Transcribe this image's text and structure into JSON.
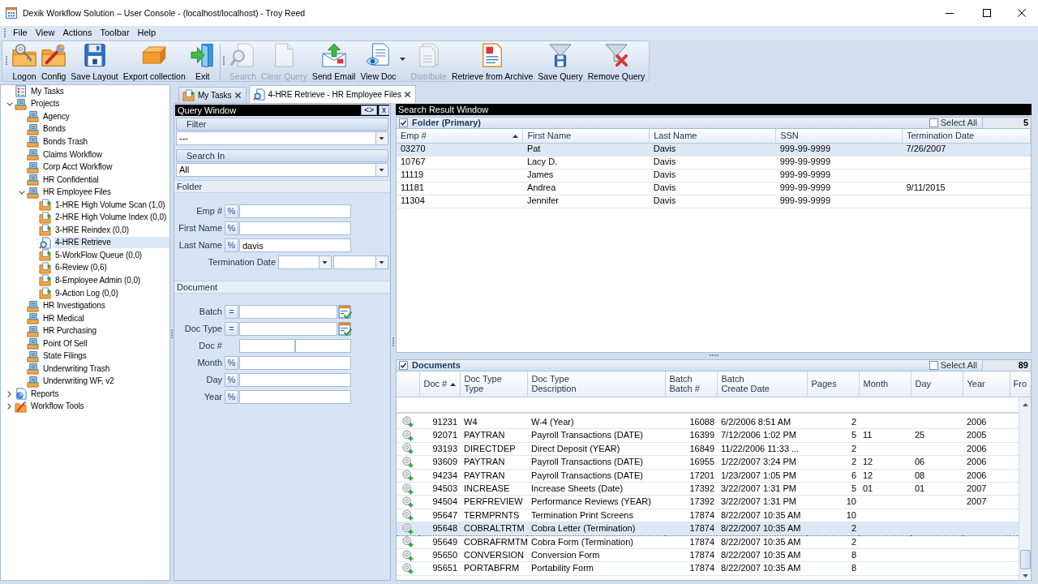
{
  "window": {
    "title": "Dexik Workflow Solution – User Console - (localhost/localhost) - Troy Reed"
  },
  "menu": [
    "File",
    "View",
    "Actions",
    "Toolbar",
    "Help"
  ],
  "toolbar": {
    "groups": [
      {
        "items": [
          {
            "label": "Logon",
            "disabled": false
          },
          {
            "label": "Config",
            "disabled": false
          },
          {
            "label": "Save Layout",
            "disabled": false
          },
          {
            "label": "Export collection",
            "disabled": false
          },
          {
            "label": "Exit",
            "disabled": false
          }
        ]
      },
      {
        "items": [
          {
            "label": "Search",
            "disabled": true
          },
          {
            "label": "Clear Query",
            "disabled": true
          },
          {
            "label": "Send Email",
            "disabled": false
          },
          {
            "label": "View Doc",
            "disabled": false,
            "dropdown": true
          },
          {
            "label": "Distribute",
            "disabled": true
          },
          {
            "label": "Retrieve from Archive",
            "disabled": false
          },
          {
            "label": "Save Query",
            "disabled": false
          },
          {
            "label": "Remove Query",
            "disabled": false
          }
        ]
      }
    ]
  },
  "tree": [
    {
      "label": "My Tasks",
      "kind": "tasks",
      "selected": false
    },
    {
      "label": "Projects",
      "kind": "project",
      "expanded": true,
      "selected": false,
      "children": [
        {
          "label": "Agency",
          "kind": "project",
          "selected": false
        },
        {
          "label": "Bonds",
          "kind": "project",
          "selected": false
        },
        {
          "label": "Bonds Trash",
          "kind": "project",
          "selected": false
        },
        {
          "label": "Claims Workflow",
          "kind": "project",
          "selected": false
        },
        {
          "label": "Corp Acct Workflow",
          "kind": "project",
          "selected": false
        },
        {
          "label": "HR Confidential",
          "kind": "project",
          "selected": false
        },
        {
          "label": "HR Employee Files",
          "kind": "project",
          "expanded": true,
          "selected": false,
          "children": [
            {
              "label": "1-HRE High Volume Scan (1,0)",
              "kind": "queue",
              "selected": false
            },
            {
              "label": "2-HRE High Volume Index (0,0)",
              "kind": "queue",
              "selected": false
            },
            {
              "label": "3-HRE Reindex (0,0)",
              "kind": "queue",
              "selected": false
            },
            {
              "label": "4-HRE Retrieve",
              "kind": "retrieve",
              "selected": true
            },
            {
              "label": "5-WorkFlow Queue (0,0)",
              "kind": "queue",
              "selected": false
            },
            {
              "label": "6-Review (0,6)",
              "kind": "queue",
              "selected": false
            },
            {
              "label": "8-Employee Admin (0,0)",
              "kind": "queue",
              "selected": false
            },
            {
              "label": "9-Action Log (0,0)",
              "kind": "queue",
              "selected": false
            }
          ]
        },
        {
          "label": "HR Investigations",
          "kind": "project",
          "selected": false
        },
        {
          "label": "HR Medical",
          "kind": "project",
          "selected": false
        },
        {
          "label": "HR Purchasing",
          "kind": "project",
          "selected": false
        },
        {
          "label": "Point Of Sell",
          "kind": "project",
          "selected": false
        },
        {
          "label": "State Filings",
          "kind": "project",
          "selected": false
        },
        {
          "label": "Underwriting Trash",
          "kind": "project",
          "selected": false
        },
        {
          "label": "Underwriting WF, v2",
          "kind": "project",
          "selected": false
        }
      ]
    },
    {
      "label": "Reports",
      "kind": "reports",
      "expanded": false,
      "selected": false
    },
    {
      "label": "Workflow Tools",
      "kind": "tools",
      "expanded": false,
      "selected": false
    }
  ],
  "tabs": [
    {
      "label": "My Tasks",
      "kind": "queue",
      "selected": false
    },
    {
      "label": "4-HRE Retrieve - HR Employee Files",
      "kind": "retrieve",
      "selected": true
    }
  ],
  "query_window": {
    "title": "Query Window",
    "buttons": [
      "<>",
      "x"
    ],
    "filter": {
      "label": "Filter",
      "value": "---"
    },
    "search_in": {
      "label": "Search In",
      "value": "All"
    },
    "sections": [
      {
        "title": "Folder",
        "fields": [
          {
            "label": "Emp #",
            "kind": "text",
            "operator": "%"
          },
          {
            "label": "First Name",
            "kind": "text",
            "operator": "%"
          },
          {
            "label": "Last Name",
            "kind": "text",
            "operator": "%",
            "value": "davis"
          },
          {
            "label": "Termination Date",
            "kind": "date_range"
          }
        ]
      },
      {
        "title": "Document",
        "fields": [
          {
            "label": "Batch",
            "kind": "lookup",
            "operator": "="
          },
          {
            "label": "Doc Type",
            "kind": "lookup",
            "operator": "="
          },
          {
            "label": "Doc #",
            "kind": "range"
          },
          {
            "label": "Month",
            "kind": "text",
            "operator": "%"
          },
          {
            "label": "Day",
            "kind": "text",
            "operator": "%"
          },
          {
            "label": "Year",
            "kind": "text",
            "operator": "%"
          }
        ]
      }
    ]
  },
  "search_results": {
    "title": "Search Result Window",
    "folder": {
      "title": "Folder (Primary)",
      "checked": true,
      "select_all": {
        "label": "Select All",
        "checked": false
      },
      "count": "5",
      "columns": [
        {
          "label": "Emp #",
          "sorted": true
        },
        {
          "label": "First Name",
          "sorted": false
        },
        {
          "label": "Last Name",
          "sorted": false
        },
        {
          "label": "SSN",
          "sorted": false
        },
        {
          "label": "Termination Date",
          "sorted": false
        }
      ],
      "rows": [
        {
          "cells": [
            "03270",
            "Pat",
            "Davis",
            "999-99-9999",
            "7/26/2007"
          ],
          "selected": true
        },
        {
          "cells": [
            "10767",
            "Lacy D.",
            "Davis",
            "999-99-9999"
          ],
          "selected": false
        },
        {
          "cells": [
            "11119",
            "James",
            "Davis",
            "999-99-9999"
          ],
          "selected": false
        },
        {
          "cells": [
            "11181",
            "Andrea",
            "Davis",
            "999-99-9999",
            "9/11/2015"
          ],
          "selected": false
        },
        {
          "cells": [
            "11304",
            "Jennifer",
            "Davis",
            "999-99-9999"
          ],
          "selected": false
        }
      ]
    },
    "documents": {
      "title": "Documents",
      "checked": true,
      "select_all": {
        "label": "Select All",
        "checked": false
      },
      "count": "89",
      "columns": [
        {
          "label": "Doc #",
          "sorted": true
        },
        {
          "group": "Doc Type",
          "label": "Type",
          "sorted": false
        },
        {
          "group": "Doc Type",
          "label": "Description",
          "sorted": false
        },
        {
          "group": "Batch",
          "label": "Batch #",
          "sorted": false
        },
        {
          "group": "Batch",
          "label": "Create Date",
          "sorted": false
        },
        {
          "label": "Pages",
          "sorted": false
        },
        {
          "label": "Month",
          "sorted": false
        },
        {
          "label": "Day",
          "sorted": false
        },
        {
          "label": "Year",
          "sorted": false
        },
        {
          "label": "Fro",
          "sorted": false
        }
      ],
      "rows": [
        {
          "cells": [
            "91231",
            "W4",
            "W-4 (Year)",
            "16088",
            "6/2/2006 8:51 AM",
            "2",
            null,
            null,
            "2006"
          ],
          "selected": false
        },
        {
          "cells": [
            "92071",
            "PAYTRAN",
            "Payroll Transactions (DATE)",
            "16399",
            "7/12/2006 1:02 PM",
            "5",
            "11",
            "25",
            "2005"
          ],
          "selected": false
        },
        {
          "cells": [
            "93193",
            "DIRECTDEP",
            "Direct Deposit (YEAR)",
            "16849",
            "11/22/2006 11:33 ...",
            "2",
            null,
            null,
            "2006"
          ],
          "selected": false
        },
        {
          "cells": [
            "93609",
            "PAYTRAN",
            "Payroll Transactions (DATE)",
            "16955",
            "1/22/2007 3:24 PM",
            "2",
            "12",
            "06",
            "2006"
          ],
          "selected": false
        },
        {
          "cells": [
            "94234",
            "PAYTRAN",
            "Payroll Transactions (DATE)",
            "17201",
            "1/23/2007 1:05 PM",
            "6",
            "12",
            "08",
            "2006"
          ],
          "selected": false
        },
        {
          "cells": [
            "94503",
            "INCREASE",
            "Increase Sheets (Date)",
            "17392",
            "3/22/2007 1:31 PM",
            "5",
            "01",
            "01",
            "2007"
          ],
          "selected": false
        },
        {
          "cells": [
            "94504",
            "PERFREVIEW",
            "Performance Reviews (YEAR)",
            "17392",
            "3/22/2007 1:31 PM",
            "10",
            null,
            null,
            "2007"
          ],
          "selected": false
        },
        {
          "cells": [
            "95647",
            "TERMPRNTS",
            "Termination Print Screens",
            "17874",
            "8/22/2007 10:35 AM",
            "10"
          ],
          "selected": false
        },
        {
          "cells": [
            "95648",
            "COBRALTRTM",
            "Cobra Letter (Termination)",
            "17874",
            "8/22/2007 10:35 AM",
            "2"
          ],
          "selected": true
        },
        {
          "cells": [
            "95649",
            "COBRAFRMTM",
            "Cobra Form (Termination)",
            "17874",
            "8/22/2007 10:35 AM",
            "2"
          ],
          "selected": false
        },
        {
          "cells": [
            "95650",
            "CONVERSION",
            "Conversion Form",
            "17874",
            "8/22/2007 10:35 AM",
            "8"
          ],
          "selected": false
        },
        {
          "cells": [
            "95651",
            "PORTABFRM",
            "Portability Form",
            "17874",
            "8/22/2007 10:35 AM",
            "8"
          ],
          "selected": false
        }
      ]
    }
  }
}
